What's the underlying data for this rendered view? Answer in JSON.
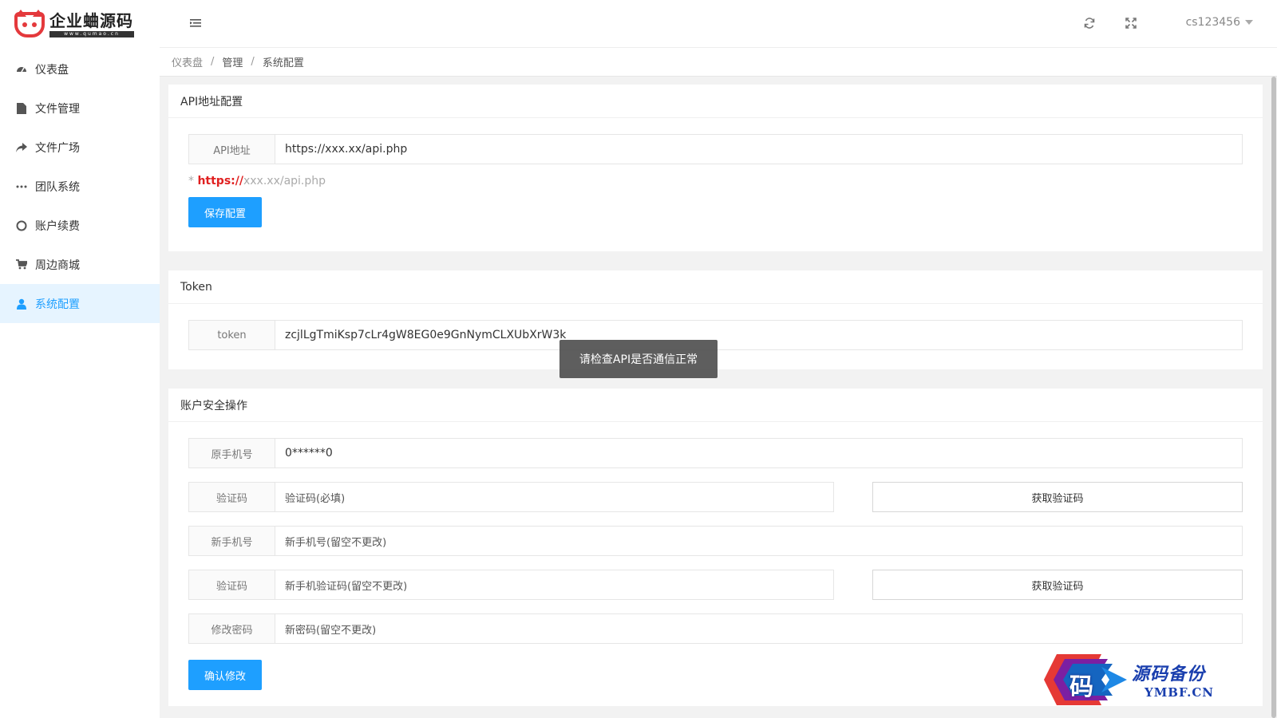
{
  "app": {
    "logo_name": "企业蛐源码",
    "logo_url": "www.qumao.cn"
  },
  "sidebar": {
    "items": [
      {
        "label": "仪表盘",
        "icon": "dashboard-icon"
      },
      {
        "label": "文件管理",
        "icon": "file-icon"
      },
      {
        "label": "文件广场",
        "icon": "share-icon"
      },
      {
        "label": "团队系统",
        "icon": "ellipsis-icon"
      },
      {
        "label": "账户续费",
        "icon": "circle-icon"
      },
      {
        "label": "周边商城",
        "icon": "cart-icon"
      },
      {
        "label": "系统配置",
        "icon": "user-icon",
        "active": true
      }
    ]
  },
  "header": {
    "username": "cs123456"
  },
  "breadcrumb": {
    "items": [
      "仪表盘",
      "管理",
      "系统配置"
    ]
  },
  "api_config": {
    "title": "API地址配置",
    "label": "API地址",
    "value": "https://xxx.xx/api.php",
    "hint_star": "*",
    "hint_protocol": "https://",
    "hint_rest": "xxx.xx/api.php",
    "save_button": "保存配置"
  },
  "token": {
    "title": "Token",
    "label": "token",
    "value": "zcjlLgTmiKsp7cLr4gW8EG0e9GnNymCLXUbXrW3k"
  },
  "toast": {
    "message": "请检查API是否通信正常"
  },
  "security": {
    "title": "账户安全操作",
    "old_phone_label": "原手机号",
    "old_phone_value": "0******0",
    "code_label": "验证码",
    "code_placeholder": "验证码(必填)",
    "get_code_button": "获取验证码",
    "new_phone_label": "新手机号",
    "new_phone_placeholder": "新手机号(留空不更改)",
    "new_code_label": "验证码",
    "new_code_placeholder": "新手机验证码(留空不更改)",
    "get_code_button_2": "获取验证码",
    "password_label": "修改密码",
    "password_placeholder": "新密码(留空不更改)",
    "confirm_button": "确认修改"
  },
  "watermark": {
    "char": "码",
    "cn": "源码备份",
    "en": "YMBF.CN"
  },
  "colors": {
    "accent": "#1e9fff",
    "brand_red": "#e4393c",
    "hint_red": "#e02020",
    "active_bg": "#e6f4ff"
  }
}
